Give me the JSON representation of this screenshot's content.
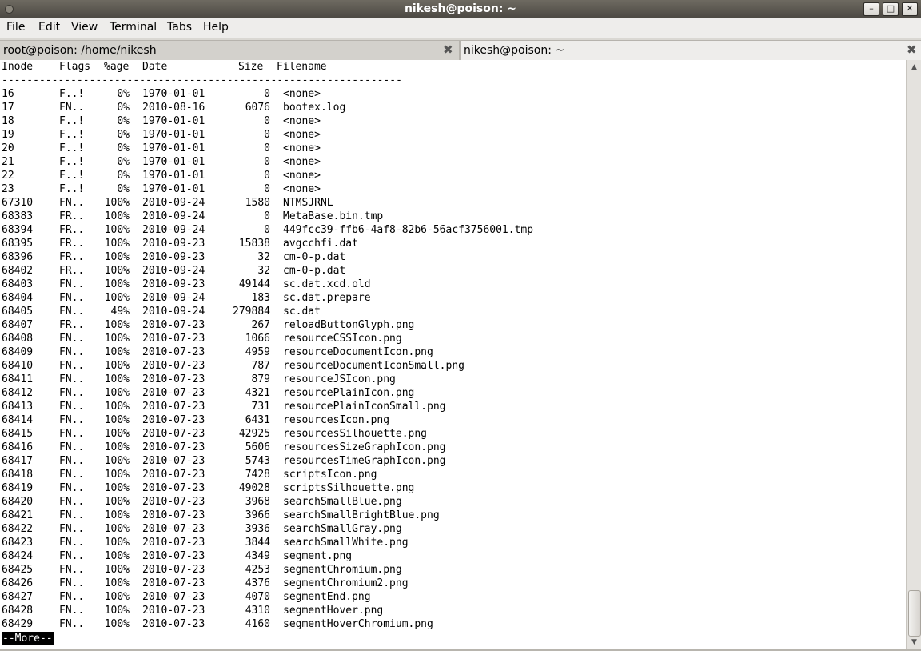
{
  "window": {
    "title": "nikesh@poison: ~"
  },
  "menubar": {
    "items": [
      "File",
      "Edit",
      "View",
      "Terminal",
      "Tabs",
      "Help"
    ]
  },
  "tabs": [
    {
      "label": "root@poison: /home/nikesh",
      "close": "✖"
    },
    {
      "label": "nikesh@poison: ~",
      "close": "✖"
    }
  ],
  "terminal": {
    "header": {
      "inode": "Inode",
      "flags": "Flags",
      "age": "%age",
      "date": "Date",
      "size": "Size",
      "filename": "Filename"
    },
    "separator": "----------------------------------------------------------------",
    "rows": [
      [
        "16",
        "F..!",
        "0%",
        "1970-01-01",
        "0",
        "<none>"
      ],
      [
        "17",
        "FN..",
        "0%",
        "2010-08-16",
        "6076",
        "bootex.log"
      ],
      [
        "18",
        "F..!",
        "0%",
        "1970-01-01",
        "0",
        "<none>"
      ],
      [
        "19",
        "F..!",
        "0%",
        "1970-01-01",
        "0",
        "<none>"
      ],
      [
        "20",
        "F..!",
        "0%",
        "1970-01-01",
        "0",
        "<none>"
      ],
      [
        "21",
        "F..!",
        "0%",
        "1970-01-01",
        "0",
        "<none>"
      ],
      [
        "22",
        "F..!",
        "0%",
        "1970-01-01",
        "0",
        "<none>"
      ],
      [
        "23",
        "F..!",
        "0%",
        "1970-01-01",
        "0",
        "<none>"
      ],
      [
        "67310",
        "FN..",
        "100%",
        "2010-09-24",
        "1580",
        "NTMSJRNL"
      ],
      [
        "68383",
        "FR..",
        "100%",
        "2010-09-24",
        "0",
        "MetaBase.bin.tmp"
      ],
      [
        "68394",
        "FR..",
        "100%",
        "2010-09-24",
        "0",
        "449fcc39-ffb6-4af8-82b6-56acf3756001.tmp"
      ],
      [
        "68395",
        "FR..",
        "100%",
        "2010-09-23",
        "15838",
        "avgcchfi.dat"
      ],
      [
        "68396",
        "FR..",
        "100%",
        "2010-09-23",
        "32",
        "cm-0-p.dat"
      ],
      [
        "68402",
        "FR..",
        "100%",
        "2010-09-24",
        "32",
        "cm-0-p.dat"
      ],
      [
        "68403",
        "FN..",
        "100%",
        "2010-09-23",
        "49144",
        "sc.dat.xcd.old"
      ],
      [
        "68404",
        "FN..",
        "100%",
        "2010-09-24",
        "183",
        "sc.dat.prepare"
      ],
      [
        "68405",
        "FN..",
        "49%",
        "2010-09-24",
        "279884",
        "sc.dat"
      ],
      [
        "68407",
        "FR..",
        "100%",
        "2010-07-23",
        "267",
        "reloadButtonGlyph.png"
      ],
      [
        "68408",
        "FN..",
        "100%",
        "2010-07-23",
        "1066",
        "resourceCSSIcon.png"
      ],
      [
        "68409",
        "FN..",
        "100%",
        "2010-07-23",
        "4959",
        "resourceDocumentIcon.png"
      ],
      [
        "68410",
        "FN..",
        "100%",
        "2010-07-23",
        "787",
        "resourceDocumentIconSmall.png"
      ],
      [
        "68411",
        "FN..",
        "100%",
        "2010-07-23",
        "879",
        "resourceJSIcon.png"
      ],
      [
        "68412",
        "FN..",
        "100%",
        "2010-07-23",
        "4321",
        "resourcePlainIcon.png"
      ],
      [
        "68413",
        "FN..",
        "100%",
        "2010-07-23",
        "731",
        "resourcePlainIconSmall.png"
      ],
      [
        "68414",
        "FN..",
        "100%",
        "2010-07-23",
        "6431",
        "resourcesIcon.png"
      ],
      [
        "68415",
        "FN..",
        "100%",
        "2010-07-23",
        "42925",
        "resourcesSilhouette.png"
      ],
      [
        "68416",
        "FN..",
        "100%",
        "2010-07-23",
        "5606",
        "resourcesSizeGraphIcon.png"
      ],
      [
        "68417",
        "FN..",
        "100%",
        "2010-07-23",
        "5743",
        "resourcesTimeGraphIcon.png"
      ],
      [
        "68418",
        "FN..",
        "100%",
        "2010-07-23",
        "7428",
        "scriptsIcon.png"
      ],
      [
        "68419",
        "FN..",
        "100%",
        "2010-07-23",
        "49028",
        "scriptsSilhouette.png"
      ],
      [
        "68420",
        "FN..",
        "100%",
        "2010-07-23",
        "3968",
        "searchSmallBlue.png"
      ],
      [
        "68421",
        "FN..",
        "100%",
        "2010-07-23",
        "3966",
        "searchSmallBrightBlue.png"
      ],
      [
        "68422",
        "FN..",
        "100%",
        "2010-07-23",
        "3936",
        "searchSmallGray.png"
      ],
      [
        "68423",
        "FN..",
        "100%",
        "2010-07-23",
        "3844",
        "searchSmallWhite.png"
      ],
      [
        "68424",
        "FN..",
        "100%",
        "2010-07-23",
        "4349",
        "segment.png"
      ],
      [
        "68425",
        "FN..",
        "100%",
        "2010-07-23",
        "4253",
        "segmentChromium.png"
      ],
      [
        "68426",
        "FN..",
        "100%",
        "2010-07-23",
        "4376",
        "segmentChromium2.png"
      ],
      [
        "68427",
        "FN..",
        "100%",
        "2010-07-23",
        "4070",
        "segmentEnd.png"
      ],
      [
        "68428",
        "FN..",
        "100%",
        "2010-07-23",
        "4310",
        "segmentHover.png"
      ],
      [
        "68429",
        "FN..",
        "100%",
        "2010-07-23",
        "4160",
        "segmentHoverChromium.png"
      ]
    ],
    "pager_prompt": "--More--"
  },
  "window_controls": {
    "minimize": "–",
    "maximize": "□",
    "close": "✕"
  },
  "icons": {
    "scroll_up": "scroll-up-arrow-icon",
    "scroll_down": "scroll-down-arrow-icon",
    "tab_close": "close-icon"
  }
}
